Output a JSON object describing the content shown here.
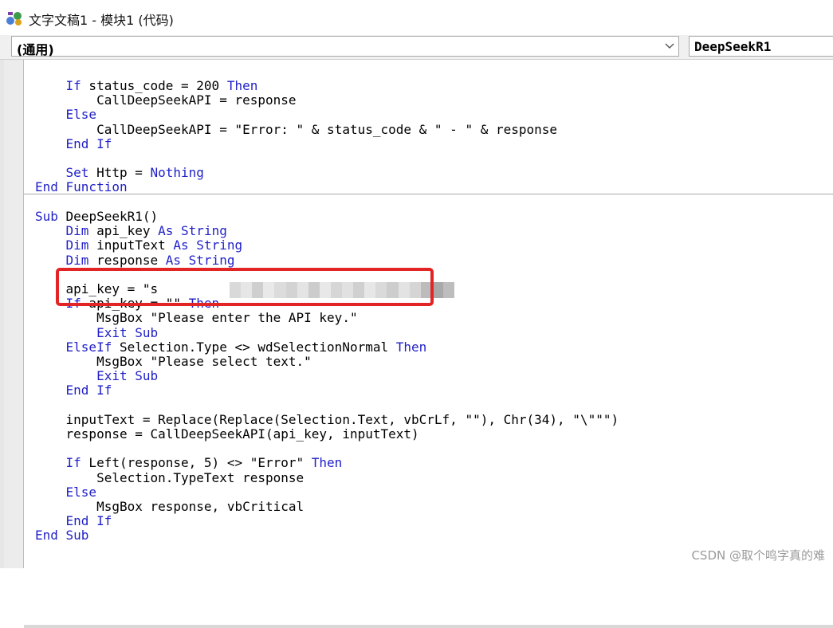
{
  "window": {
    "title": "文字文稿1 - 模块1 (代码)",
    "icon": "vba-module-icon"
  },
  "combos": {
    "object": {
      "value": "(通用)"
    },
    "procedure": {
      "value": "DeepSeekR1"
    }
  },
  "code": {
    "lines_top": [
      [
        [
          "    ",
          "tx"
        ],
        [
          "If",
          "kw"
        ],
        [
          " status_code = 200 ",
          "tx"
        ],
        [
          "Then",
          "kw"
        ]
      ],
      [
        [
          "        CallDeepSeekAPI = response",
          "tx"
        ]
      ],
      [
        [
          "    ",
          "tx"
        ],
        [
          "Else",
          "kw"
        ]
      ],
      [
        [
          "        CallDeepSeekAPI = \"Error: \" & status_code & \" - \" & response",
          "tx"
        ]
      ],
      [
        [
          "    ",
          "tx"
        ],
        [
          "End If",
          "kw"
        ]
      ],
      [
        [
          "",
          "tx"
        ]
      ],
      [
        [
          "    ",
          "tx"
        ],
        [
          "Set",
          "kw"
        ],
        [
          " Http = ",
          "tx"
        ],
        [
          "Nothing",
          "kw"
        ]
      ],
      [
        [
          "End Function",
          "kw"
        ]
      ]
    ],
    "lines_bottom": [
      [
        [
          "Sub",
          "kw"
        ],
        [
          " DeepSeekR1()",
          "tx"
        ]
      ],
      [
        [
          "    ",
          "tx"
        ],
        [
          "Dim",
          "kw"
        ],
        [
          " api_key ",
          "tx"
        ],
        [
          "As String",
          "kw"
        ]
      ],
      [
        [
          "    ",
          "tx"
        ],
        [
          "Dim",
          "kw"
        ],
        [
          " inputText ",
          "tx"
        ],
        [
          "As String",
          "kw"
        ]
      ],
      [
        [
          "    ",
          "tx"
        ],
        [
          "Dim",
          "kw"
        ],
        [
          " response ",
          "tx"
        ],
        [
          "As String",
          "kw"
        ]
      ],
      [
        [
          "",
          "tx"
        ]
      ],
      [
        [
          "    api_key = \"s",
          "tx"
        ]
      ],
      [
        [
          "    ",
          "tx"
        ],
        [
          "If",
          "kw"
        ],
        [
          " api_key = \"\" ",
          "tx"
        ],
        [
          "Then",
          "kw"
        ]
      ],
      [
        [
          "        MsgBox \"Please enter the API key.\"",
          "tx"
        ]
      ],
      [
        [
          "        ",
          "tx"
        ],
        [
          "Exit Sub",
          "kw"
        ]
      ],
      [
        [
          "    ",
          "tx"
        ],
        [
          "ElseIf",
          "kw"
        ],
        [
          " Selection.Type <> wdSelectionNormal ",
          "tx"
        ],
        [
          "Then",
          "kw"
        ]
      ],
      [
        [
          "        MsgBox \"Please select text.\"",
          "tx"
        ]
      ],
      [
        [
          "        ",
          "tx"
        ],
        [
          "Exit Sub",
          "kw"
        ]
      ],
      [
        [
          "    ",
          "tx"
        ],
        [
          "End If",
          "kw"
        ]
      ],
      [
        [
          "",
          "tx"
        ]
      ],
      [
        [
          "    inputText = Replace(Replace(Selection.Text, vbCrLf, \"\"), Chr(34), \"\\\"\"\")",
          "tx"
        ]
      ],
      [
        [
          "    response = CallDeepSeekAPI(api_key, inputText)",
          "tx"
        ]
      ],
      [
        [
          "",
          "tx"
        ]
      ],
      [
        [
          "    ",
          "tx"
        ],
        [
          "If",
          "kw"
        ],
        [
          " Left(response, 5) <> \"Error\" ",
          "tx"
        ],
        [
          "Then",
          "kw"
        ]
      ],
      [
        [
          "        Selection.TypeText response",
          "tx"
        ]
      ],
      [
        [
          "    ",
          "tx"
        ],
        [
          "Else",
          "kw"
        ]
      ],
      [
        [
          "        MsgBox response, vbCritical",
          "tx"
        ]
      ],
      [
        [
          "    ",
          "tx"
        ],
        [
          "End If",
          "kw"
        ]
      ],
      [
        [
          "End Sub",
          "kw"
        ]
      ]
    ],
    "colors": {
      "keyword": "#1f1fc8",
      "text": "#000000",
      "highlight": "#e32424"
    }
  },
  "watermark": "CSDN @取个鸣字真的难"
}
